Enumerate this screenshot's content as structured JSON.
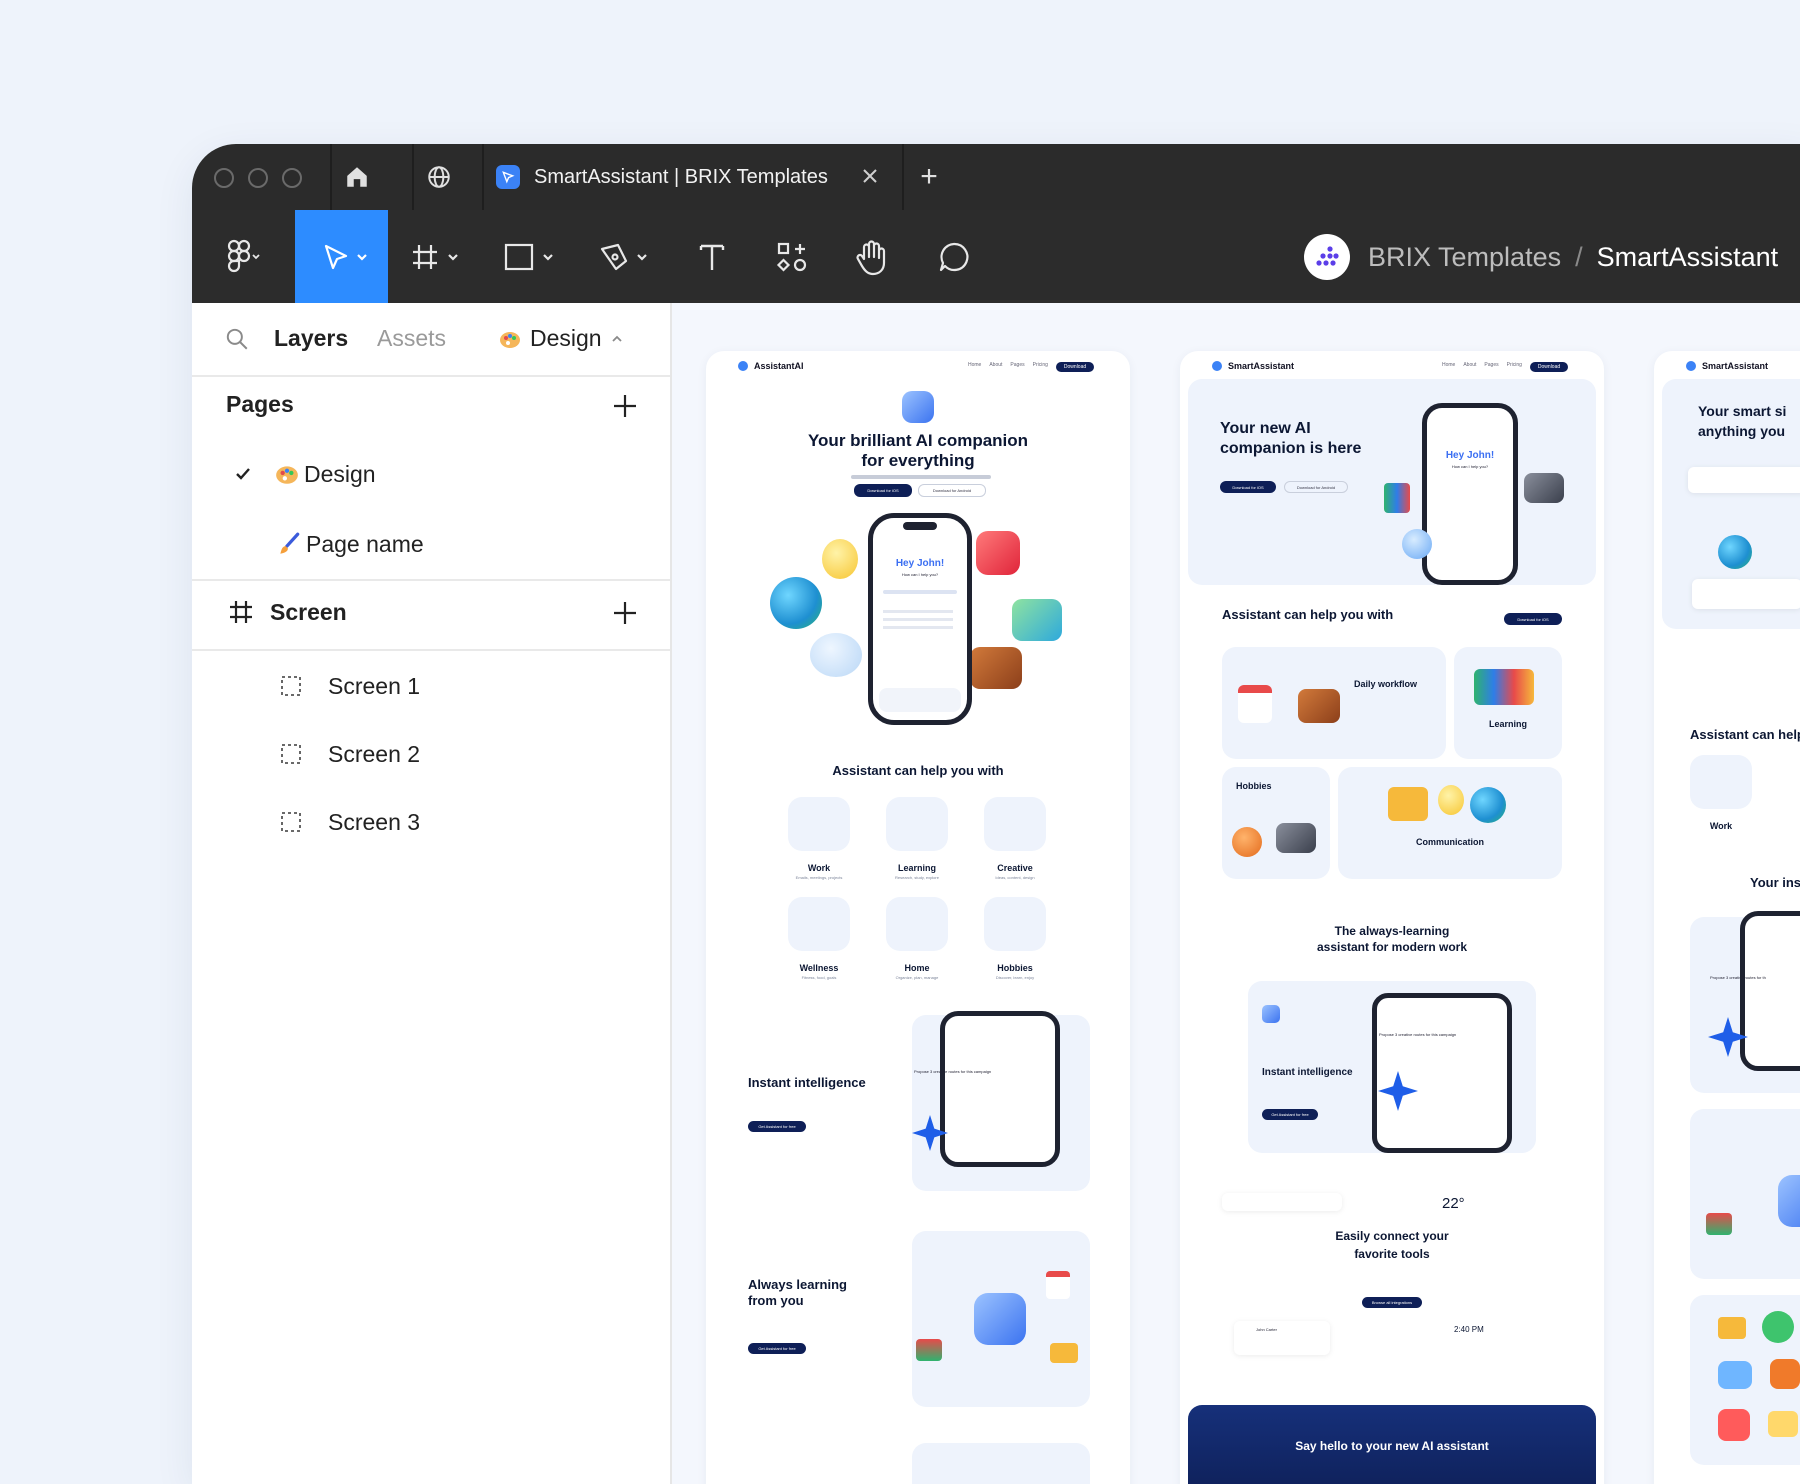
{
  "tabbar": {
    "tab_title": "SmartAssistant | BRIX Templates",
    "new_tab_symbol": "+"
  },
  "toolbar": {
    "team": "BRIX Templates",
    "separator": "/",
    "file": "SmartAssistant",
    "tools": [
      "figma-menu",
      "move",
      "frame",
      "rectangle",
      "pen",
      "text",
      "resources",
      "hand",
      "comment"
    ],
    "active_color": "#2d8cff"
  },
  "sidebar": {
    "tabs": {
      "layers": "Layers",
      "assets": "Assets",
      "page_selector": "Design"
    },
    "pages_title": "Pages",
    "pages": [
      {
        "label": "Design",
        "checked": true
      },
      {
        "label": "Page name",
        "checked": false
      }
    ],
    "screen_title": "Screen",
    "screens": [
      "Screen 1",
      "Screen 2",
      "Screen 3"
    ]
  },
  "frames": {
    "f1": {
      "brand": "AssistantAI",
      "nav": [
        "Home",
        "About",
        "Pages",
        "Pricing"
      ],
      "nav_cta": "Download",
      "hero_title_1": "Your brilliant AI companion",
      "hero_title_2": "for everything",
      "hero_btn_ios": "Download for iOS",
      "hero_btn_android": "Download for Android",
      "phone_greeting": "Hey John!",
      "phone_sub": "How can I help you?",
      "section_title": "Assistant can help you with",
      "categories": [
        {
          "name": "Work",
          "sub": "Emails, meetings, projects"
        },
        {
          "name": "Learning",
          "sub": "Research, study, explore"
        },
        {
          "name": "Creative",
          "sub": "Ideas, content, design"
        },
        {
          "name": "Wellness",
          "sub": "Fitness, food, goals"
        },
        {
          "name": "Home",
          "sub": "Organize, plan, manage"
        },
        {
          "name": "Hobbies",
          "sub": "Discover, learn, enjoy"
        }
      ],
      "instant_title": "Instant intelligence",
      "instant_btn": "Get Assistant for free",
      "instant_prompt": "Propose 3 creative routes for this campaign",
      "always_title_1": "Always learning",
      "always_title_2": "from you",
      "always_btn": "Get Assistant for free"
    },
    "f2": {
      "brand": "SmartAssistant",
      "nav": [
        "Home",
        "About",
        "Pages",
        "Pricing"
      ],
      "nav_cta": "Download",
      "hero_title_1": "Your new AI",
      "hero_title_2": "companion is here",
      "hero_btn_ios": "Download for iOS",
      "hero_btn_android": "Download for Android",
      "phone_greeting": "Hey John!",
      "phone_sub": "How can I help you?",
      "section_title": "Assistant can help you with",
      "section_btn": "Download for iOS",
      "cards": [
        "Daily workflow",
        "Learning",
        "Hobbies",
        "Communication"
      ],
      "learning_title_1": "The always-learning",
      "learning_title_2": "assistant for modern work",
      "instant_title": "Instant intelligence",
      "instant_btn": "Get Assistant for free",
      "instant_prompt": "Propose 3 creative routes for this campaign",
      "weather_temp": "22°",
      "connect_title_1": "Easily connect your",
      "connect_title_2": "favorite tools",
      "connect_btn": "Browse all integrations",
      "clock": "2:40 PM",
      "contact_name": "John Carter",
      "footer_title": "Say hello to your new AI assistant"
    },
    "f3": {
      "brand": "SmartAssistant",
      "hero_title_1": "Your smart si",
      "hero_title_2": "anything you",
      "section_title": "Assistant can help",
      "work_label": "Work",
      "instant_partial": "Your inst",
      "prompt": "Propose 3 creative routes for th"
    }
  }
}
